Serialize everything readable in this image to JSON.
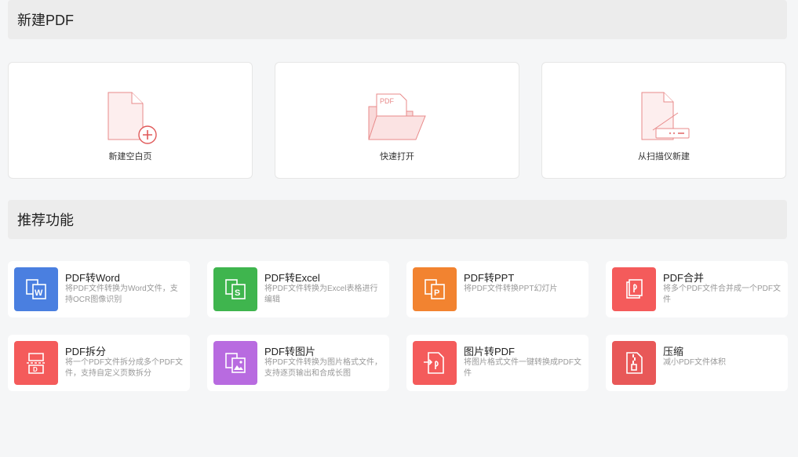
{
  "sections": {
    "new_pdf_title": "新建PDF",
    "recommended_title": "推荐功能"
  },
  "create": [
    {
      "label": "新建空白页",
      "icon": "blank-page-add-icon"
    },
    {
      "label": "快速打开",
      "icon": "folder-open-pdf-icon"
    },
    {
      "label": "从扫描仪新建",
      "icon": "scanner-document-icon"
    }
  ],
  "features": [
    {
      "title": "PDF转Word",
      "desc": "将PDF文件转换为Word文件，支持OCR图像识别",
      "color": "#4a7fe0",
      "icon": "pdf-to-word-icon"
    },
    {
      "title": "PDF转Excel",
      "desc": "将PDF文件转换为Excel表格进行编辑",
      "color": "#3fb54e",
      "icon": "pdf-to-excel-icon"
    },
    {
      "title": "PDF转PPT",
      "desc": "将PDF文件转换PPT幻灯片",
      "color": "#f28330",
      "icon": "pdf-to-ppt-icon"
    },
    {
      "title": "PDF合并",
      "desc": "将多个PDF文件合并成一个PDF文件",
      "color": "#f45b5b",
      "icon": "pdf-merge-icon"
    },
    {
      "title": "PDF拆分",
      "desc": "将一个PDF文件拆分成多个PDF文件，支持自定义页数拆分",
      "color": "#f45b5b",
      "icon": "pdf-split-icon"
    },
    {
      "title": "PDF转图片",
      "desc": "将PDF文件转换为图片格式文件，支持逐页输出和合成长图",
      "color": "#b86be0",
      "icon": "pdf-to-image-icon"
    },
    {
      "title": "图片转PDF",
      "desc": "将图片格式文件一键转换成PDF文件",
      "color": "#f45b5b",
      "icon": "image-to-pdf-icon"
    },
    {
      "title": "压缩",
      "desc": "减小PDF文件体积",
      "color": "#e85858",
      "icon": "compress-icon"
    }
  ],
  "folder_pdf_text": "PDF"
}
